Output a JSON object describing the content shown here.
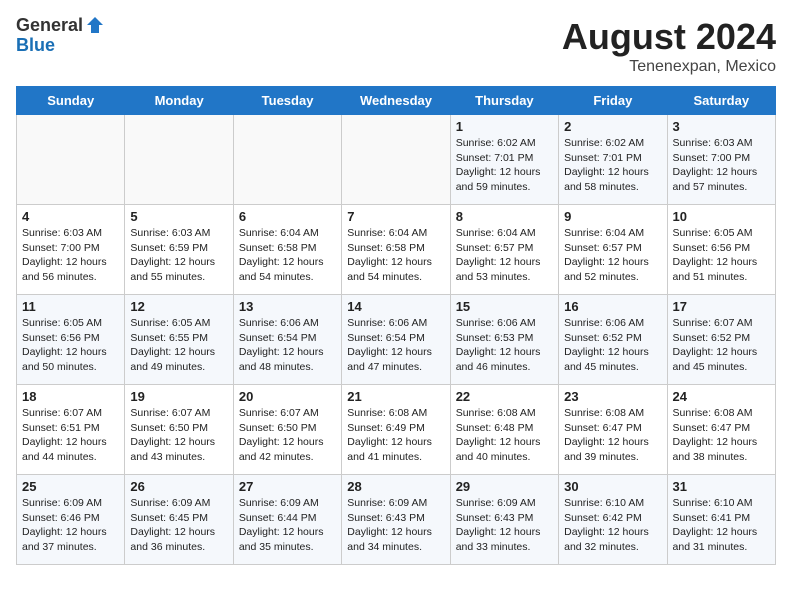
{
  "header": {
    "logo_general": "General",
    "logo_blue": "Blue",
    "month_year": "August 2024",
    "location": "Tenenexpan, Mexico"
  },
  "calendar": {
    "days_of_week": [
      "Sunday",
      "Monday",
      "Tuesday",
      "Wednesday",
      "Thursday",
      "Friday",
      "Saturday"
    ],
    "weeks": [
      [
        {
          "day": "",
          "sunrise": "",
          "sunset": "",
          "daylight": ""
        },
        {
          "day": "",
          "sunrise": "",
          "sunset": "",
          "daylight": ""
        },
        {
          "day": "",
          "sunrise": "",
          "sunset": "",
          "daylight": ""
        },
        {
          "day": "",
          "sunrise": "",
          "sunset": "",
          "daylight": ""
        },
        {
          "day": "1",
          "sunrise": "Sunrise: 6:02 AM",
          "sunset": "Sunset: 7:01 PM",
          "daylight": "Daylight: 12 hours and 59 minutes."
        },
        {
          "day": "2",
          "sunrise": "Sunrise: 6:02 AM",
          "sunset": "Sunset: 7:01 PM",
          "daylight": "Daylight: 12 hours and 58 minutes."
        },
        {
          "day": "3",
          "sunrise": "Sunrise: 6:03 AM",
          "sunset": "Sunset: 7:00 PM",
          "daylight": "Daylight: 12 hours and 57 minutes."
        }
      ],
      [
        {
          "day": "4",
          "sunrise": "Sunrise: 6:03 AM",
          "sunset": "Sunset: 7:00 PM",
          "daylight": "Daylight: 12 hours and 56 minutes."
        },
        {
          "day": "5",
          "sunrise": "Sunrise: 6:03 AM",
          "sunset": "Sunset: 6:59 PM",
          "daylight": "Daylight: 12 hours and 55 minutes."
        },
        {
          "day": "6",
          "sunrise": "Sunrise: 6:04 AM",
          "sunset": "Sunset: 6:58 PM",
          "daylight": "Daylight: 12 hours and 54 minutes."
        },
        {
          "day": "7",
          "sunrise": "Sunrise: 6:04 AM",
          "sunset": "Sunset: 6:58 PM",
          "daylight": "Daylight: 12 hours and 54 minutes."
        },
        {
          "day": "8",
          "sunrise": "Sunrise: 6:04 AM",
          "sunset": "Sunset: 6:57 PM",
          "daylight": "Daylight: 12 hours and 53 minutes."
        },
        {
          "day": "9",
          "sunrise": "Sunrise: 6:04 AM",
          "sunset": "Sunset: 6:57 PM",
          "daylight": "Daylight: 12 hours and 52 minutes."
        },
        {
          "day": "10",
          "sunrise": "Sunrise: 6:05 AM",
          "sunset": "Sunset: 6:56 PM",
          "daylight": "Daylight: 12 hours and 51 minutes."
        }
      ],
      [
        {
          "day": "11",
          "sunrise": "Sunrise: 6:05 AM",
          "sunset": "Sunset: 6:56 PM",
          "daylight": "Daylight: 12 hours and 50 minutes."
        },
        {
          "day": "12",
          "sunrise": "Sunrise: 6:05 AM",
          "sunset": "Sunset: 6:55 PM",
          "daylight": "Daylight: 12 hours and 49 minutes."
        },
        {
          "day": "13",
          "sunrise": "Sunrise: 6:06 AM",
          "sunset": "Sunset: 6:54 PM",
          "daylight": "Daylight: 12 hours and 48 minutes."
        },
        {
          "day": "14",
          "sunrise": "Sunrise: 6:06 AM",
          "sunset": "Sunset: 6:54 PM",
          "daylight": "Daylight: 12 hours and 47 minutes."
        },
        {
          "day": "15",
          "sunrise": "Sunrise: 6:06 AM",
          "sunset": "Sunset: 6:53 PM",
          "daylight": "Daylight: 12 hours and 46 minutes."
        },
        {
          "day": "16",
          "sunrise": "Sunrise: 6:06 AM",
          "sunset": "Sunset: 6:52 PM",
          "daylight": "Daylight: 12 hours and 45 minutes."
        },
        {
          "day": "17",
          "sunrise": "Sunrise: 6:07 AM",
          "sunset": "Sunset: 6:52 PM",
          "daylight": "Daylight: 12 hours and 45 minutes."
        }
      ],
      [
        {
          "day": "18",
          "sunrise": "Sunrise: 6:07 AM",
          "sunset": "Sunset: 6:51 PM",
          "daylight": "Daylight: 12 hours and 44 minutes."
        },
        {
          "day": "19",
          "sunrise": "Sunrise: 6:07 AM",
          "sunset": "Sunset: 6:50 PM",
          "daylight": "Daylight: 12 hours and 43 minutes."
        },
        {
          "day": "20",
          "sunrise": "Sunrise: 6:07 AM",
          "sunset": "Sunset: 6:50 PM",
          "daylight": "Daylight: 12 hours and 42 minutes."
        },
        {
          "day": "21",
          "sunrise": "Sunrise: 6:08 AM",
          "sunset": "Sunset: 6:49 PM",
          "daylight": "Daylight: 12 hours and 41 minutes."
        },
        {
          "day": "22",
          "sunrise": "Sunrise: 6:08 AM",
          "sunset": "Sunset: 6:48 PM",
          "daylight": "Daylight: 12 hours and 40 minutes."
        },
        {
          "day": "23",
          "sunrise": "Sunrise: 6:08 AM",
          "sunset": "Sunset: 6:47 PM",
          "daylight": "Daylight: 12 hours and 39 minutes."
        },
        {
          "day": "24",
          "sunrise": "Sunrise: 6:08 AM",
          "sunset": "Sunset: 6:47 PM",
          "daylight": "Daylight: 12 hours and 38 minutes."
        }
      ],
      [
        {
          "day": "25",
          "sunrise": "Sunrise: 6:09 AM",
          "sunset": "Sunset: 6:46 PM",
          "daylight": "Daylight: 12 hours and 37 minutes."
        },
        {
          "day": "26",
          "sunrise": "Sunrise: 6:09 AM",
          "sunset": "Sunset: 6:45 PM",
          "daylight": "Daylight: 12 hours and 36 minutes."
        },
        {
          "day": "27",
          "sunrise": "Sunrise: 6:09 AM",
          "sunset": "Sunset: 6:44 PM",
          "daylight": "Daylight: 12 hours and 35 minutes."
        },
        {
          "day": "28",
          "sunrise": "Sunrise: 6:09 AM",
          "sunset": "Sunset: 6:43 PM",
          "daylight": "Daylight: 12 hours and 34 minutes."
        },
        {
          "day": "29",
          "sunrise": "Sunrise: 6:09 AM",
          "sunset": "Sunset: 6:43 PM",
          "daylight": "Daylight: 12 hours and 33 minutes."
        },
        {
          "day": "30",
          "sunrise": "Sunrise: 6:10 AM",
          "sunset": "Sunset: 6:42 PM",
          "daylight": "Daylight: 12 hours and 32 minutes."
        },
        {
          "day": "31",
          "sunrise": "Sunrise: 6:10 AM",
          "sunset": "Sunset: 6:41 PM",
          "daylight": "Daylight: 12 hours and 31 minutes."
        }
      ]
    ]
  }
}
